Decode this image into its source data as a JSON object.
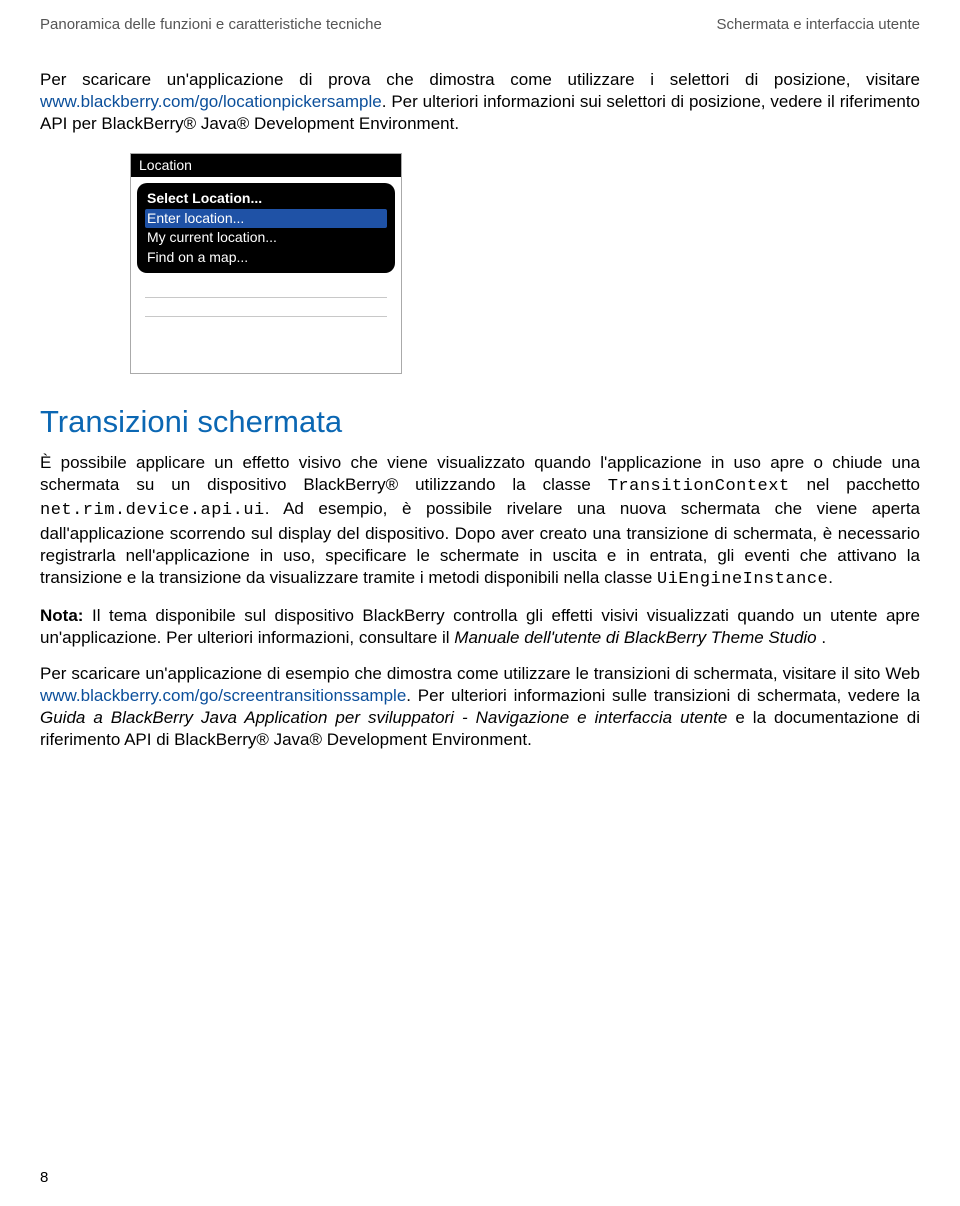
{
  "header": {
    "left": "Panoramica delle funzioni e caratteristiche tecniche",
    "right": "Schermata e interfaccia utente"
  },
  "para1": {
    "t1": "Per scaricare un'applicazione di prova che dimostra come utilizzare i selettori di posizione, visitare ",
    "link": "www.blackberry.com/go/locationpickersample",
    "t2": ". Per ulteriori informazioni sui selettori di posizione, vedere il riferimento API per BlackBerry® Java® Development Environment."
  },
  "figure": {
    "titlebar": "Location",
    "popup_title": "Select Location...",
    "items": [
      {
        "label": "Enter location...",
        "selected": true
      },
      {
        "label": "My current location...",
        "selected": false
      },
      {
        "label": "Find on a map...",
        "selected": false
      }
    ]
  },
  "h2": "Transizioni schermata",
  "para2": {
    "t1": "È possibile applicare un effetto visivo che viene visualizzato quando l'applicazione in uso apre o chiude una schermata su un dispositivo BlackBerry® utilizzando la classe ",
    "m1": "TransitionContext",
    "t2": " nel pacchetto ",
    "m2": "net.rim.device.api.ui",
    "t3": ". Ad esempio, è possibile rivelare una nuova schermata che viene aperta dall'applicazione scorrendo sul display del dispositivo. Dopo aver creato una transizione di schermata, è necessario registrarla nell'applicazione in uso, specificare le schermate in uscita e in entrata, gli eventi che attivano la transizione e la transizione da visualizzare tramite i metodi disponibili nella classe ",
    "m3": "UiEngineInstance",
    "t4": "."
  },
  "nota": {
    "label": "Nota:",
    "t1": "  Il tema disponibile sul dispositivo BlackBerry controlla gli effetti visivi visualizzati quando un utente apre un'applicazione. Per ulteriori informazioni, consultare il ",
    "i1": "Manuale dell'utente di BlackBerry Theme Studio",
    "t2": " ."
  },
  "para3": {
    "t1": "Per scaricare un'applicazione di esempio che dimostra come utilizzare le transizioni di schermata, visitare il sito Web ",
    "link": "www.blackberry.com/go/screentransitionssample",
    "t2": ". Per ulteriori informazioni sulle transizioni di schermata, vedere la  ",
    "i1": "Guida a BlackBerry Java Application per sviluppatori - Navigazione e interfaccia utente",
    "t3": " e la documentazione di riferimento API di BlackBerry® Java® Development Environment."
  },
  "page_number": "8"
}
